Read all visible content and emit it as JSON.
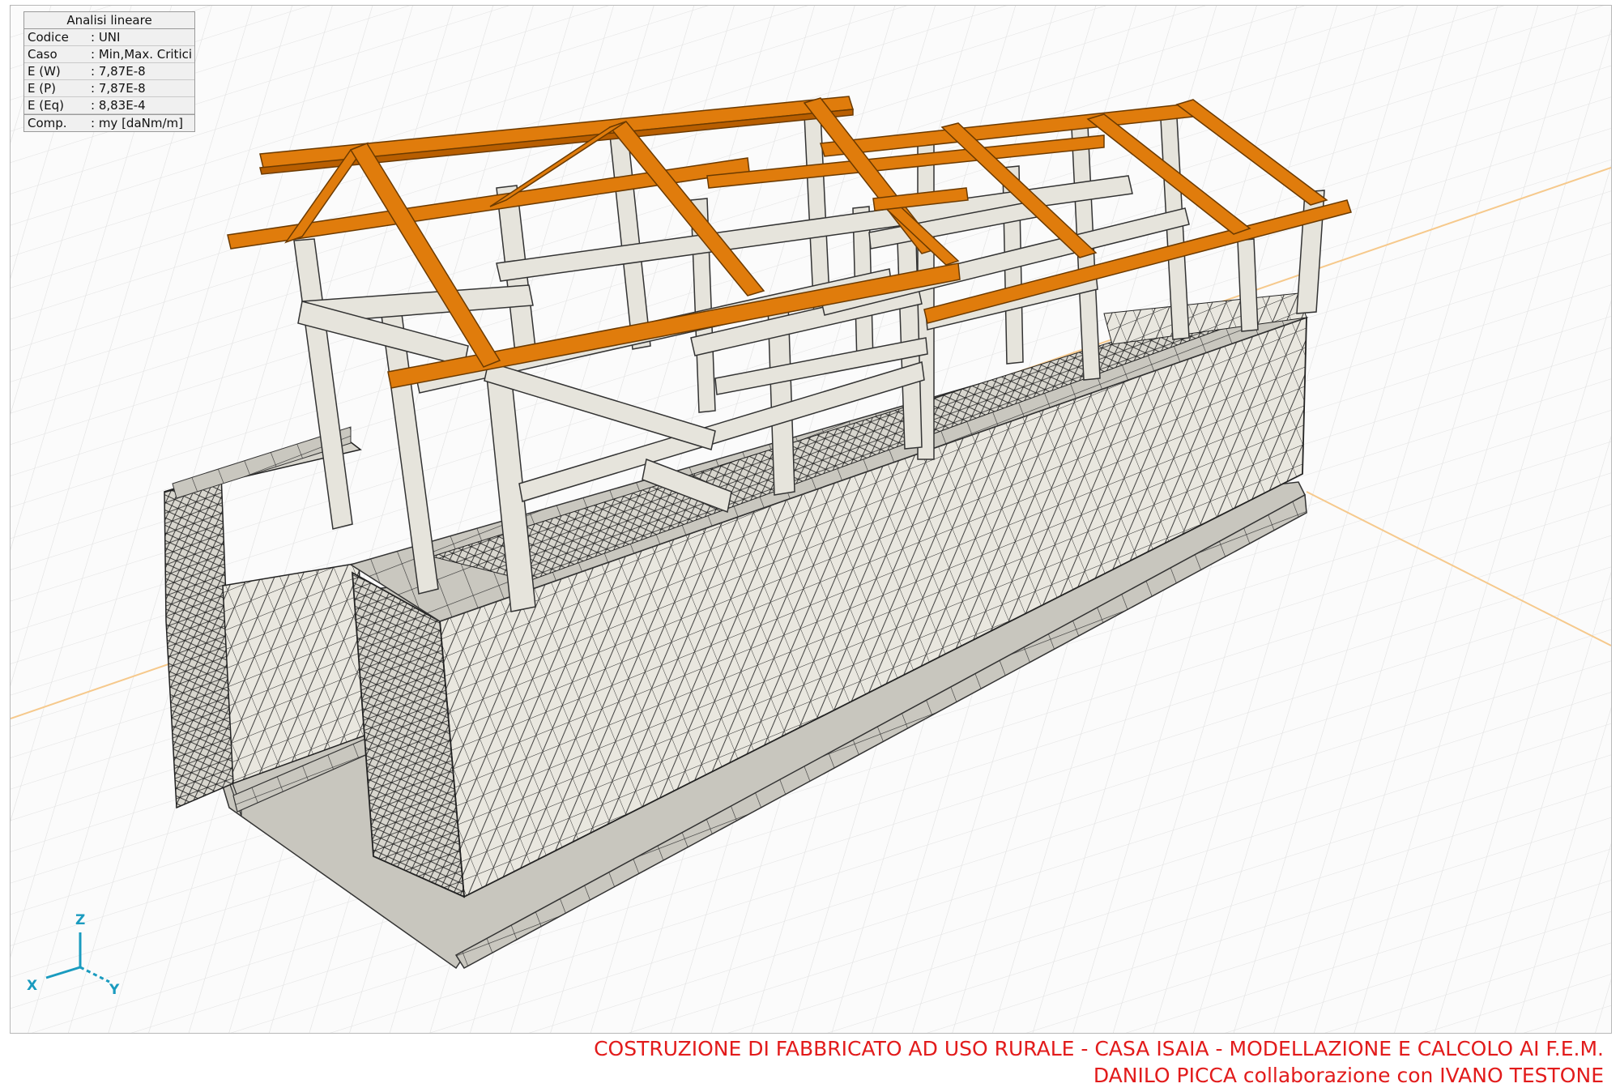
{
  "info_panel": {
    "title": "Analisi lineare",
    "rows": [
      {
        "key": "Codice",
        "value": ": UNI"
      },
      {
        "key": "Caso",
        "value": ": Min,Max. Critici"
      },
      {
        "key": "E (W)",
        "value": ": 7,87E-8"
      },
      {
        "key": "E (P)",
        "value": ": 7,87E-8"
      },
      {
        "key": "E (Eq)",
        "value": ": 8,83E-4"
      },
      {
        "key": "Comp.",
        "value": ": my [daNm/m]"
      }
    ]
  },
  "axes": {
    "z": "Z",
    "x": "X",
    "y": "Y"
  },
  "footer": {
    "line1": "COSTRUZIONE DI FABBRICATO AD USO RURALE - CASA ISAIA - MODELLAZIONE E CALCOLO AI F.E.M.",
    "line2": "DANILO PICCA collaborazione con IVANO TESTONE"
  },
  "colors": {
    "roof_beam": "#e07c0c",
    "concrete": "#e6e4dc",
    "mesh_line": "#1e1e1e",
    "grid": "#e3e3e3",
    "grid_accent": "#f6c98c",
    "axis": "#1a9bbf",
    "footer_text": "#e21b1b"
  }
}
